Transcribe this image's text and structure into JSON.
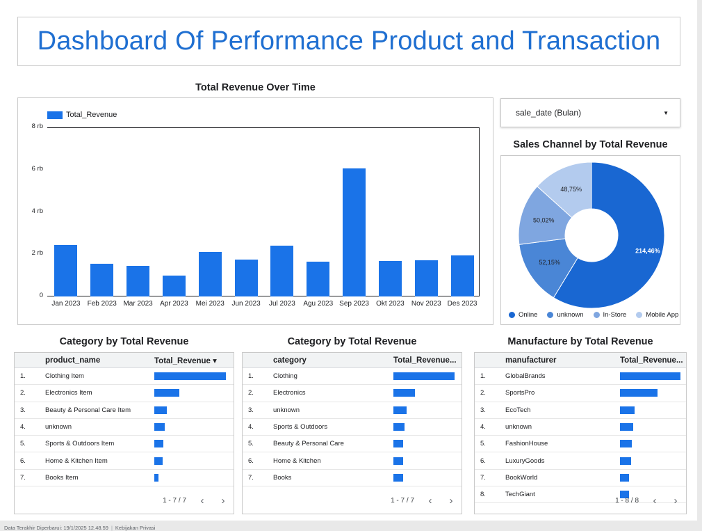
{
  "dashboard": {
    "title": "Dashboard Of Performance Product and Transaction"
  },
  "revenue_chart": {
    "title": "Total Revenue Over Time",
    "legend_label": "Total_Revenue"
  },
  "chart_data": [
    {
      "type": "bar",
      "title": "Total Revenue Over Time",
      "xlabel": "",
      "ylabel": "",
      "categories": [
        "Jan 2023",
        "Feb 2023",
        "Mar 2023",
        "Apr 2023",
        "Mei 2023",
        "Jun 2023",
        "Jul 2023",
        "Agu 2023",
        "Sep 2023",
        "Okt 2023",
        "Nov 2023",
        "Des 2023"
      ],
      "series": [
        {
          "name": "Total_Revenue",
          "values": [
            2450,
            1560,
            1450,
            1000,
            2100,
            1750,
            2400,
            1650,
            6050,
            1670,
            1700,
            1950
          ]
        }
      ],
      "ylim": [
        0,
        8000
      ],
      "yticks": [
        "0",
        "2 rb",
        "4 rb",
        "6 rb",
        "8 rb"
      ],
      "legend": "top-left",
      "grid": false,
      "color": "#1a73e8"
    },
    {
      "type": "pie",
      "title": "Sales Channel by Total Revenue",
      "labels": [
        "Online",
        "unknown",
        "In-Store",
        "Mobile App"
      ],
      "values": [
        214.46,
        52.15,
        50.02,
        48.75
      ],
      "value_labels": [
        "214,46%",
        "52,15%",
        "50,02%",
        "48,75%"
      ],
      "colors": [
        "#1967d2",
        "#4a86d6",
        "#7fa6e0",
        "#b3cbee"
      ],
      "donut": true,
      "legend": "bottom"
    }
  ],
  "date_control": {
    "label": "sale_date (Bulan)"
  },
  "pie_chart": {
    "title": "Sales Channel by Total Revenue"
  },
  "tables": [
    {
      "title": "Category by Total Revenue",
      "col1": "product_name",
      "col2": "Total_Revenue",
      "sort_indicator": "▾",
      "rows": [
        {
          "n": "1.",
          "name": "Clothing Item",
          "value": 1.0
        },
        {
          "n": "2.",
          "name": "Electronics Item",
          "value": 0.35
        },
        {
          "n": "3.",
          "name": "Beauty & Personal Care Item",
          "value": 0.17
        },
        {
          "n": "4.",
          "name": "unknown",
          "value": 0.145
        },
        {
          "n": "5.",
          "name": "Sports & Outdoors Item",
          "value": 0.125
        },
        {
          "n": "6.",
          "name": "Home & Kitchen Item",
          "value": 0.115
        },
        {
          "n": "7.",
          "name": "Books Item",
          "value": 0.055
        }
      ],
      "pager": "1 - 7 / 7"
    },
    {
      "title": "Category by Total Revenue",
      "col1": "category",
      "col2": "Total_Revenue...",
      "sort_indicator": "",
      "rows": [
        {
          "n": "1.",
          "name": "Clothing",
          "value": 1.0
        },
        {
          "n": "2.",
          "name": "Electronics",
          "value": 0.35
        },
        {
          "n": "3.",
          "name": "unknown",
          "value": 0.22
        },
        {
          "n": "4.",
          "name": "Sports & Outdoors",
          "value": 0.18
        },
        {
          "n": "5.",
          "name": "Beauty & Personal Care",
          "value": 0.16
        },
        {
          "n": "6.",
          "name": "Home & Kitchen",
          "value": 0.155
        },
        {
          "n": "7.",
          "name": "Books",
          "value": 0.155
        }
      ],
      "pager": "1 - 7 / 7"
    },
    {
      "title": "Manufacture by Total Revenue",
      "col1": "manufacturer",
      "col2": "Total_Revenue...",
      "sort_indicator": "",
      "rows": [
        {
          "n": "1.",
          "name": "GlobalBrands",
          "value": 1.0
        },
        {
          "n": "2.",
          "name": "SportsPro",
          "value": 0.62
        },
        {
          "n": "3.",
          "name": "EcoTech",
          "value": 0.24
        },
        {
          "n": "4.",
          "name": "unknown",
          "value": 0.22
        },
        {
          "n": "5.",
          "name": "FashionHouse",
          "value": 0.195
        },
        {
          "n": "6.",
          "name": "LuxuryGoods",
          "value": 0.185
        },
        {
          "n": "7.",
          "name": "BookWorld",
          "value": 0.15
        },
        {
          "n": "8.",
          "name": "TechGiant",
          "value": 0.15
        }
      ],
      "pager": "1 - 8 / 8"
    }
  ],
  "footer": {
    "updated": "Data Terakhir Diperbarui: 19/1/2025 12.48.59",
    "privacy": "Kebijakan Privasi"
  },
  "icons": {
    "prev": "chevron-left-icon",
    "next": "chevron-right-icon",
    "dropdown": "caret-down-icon"
  }
}
